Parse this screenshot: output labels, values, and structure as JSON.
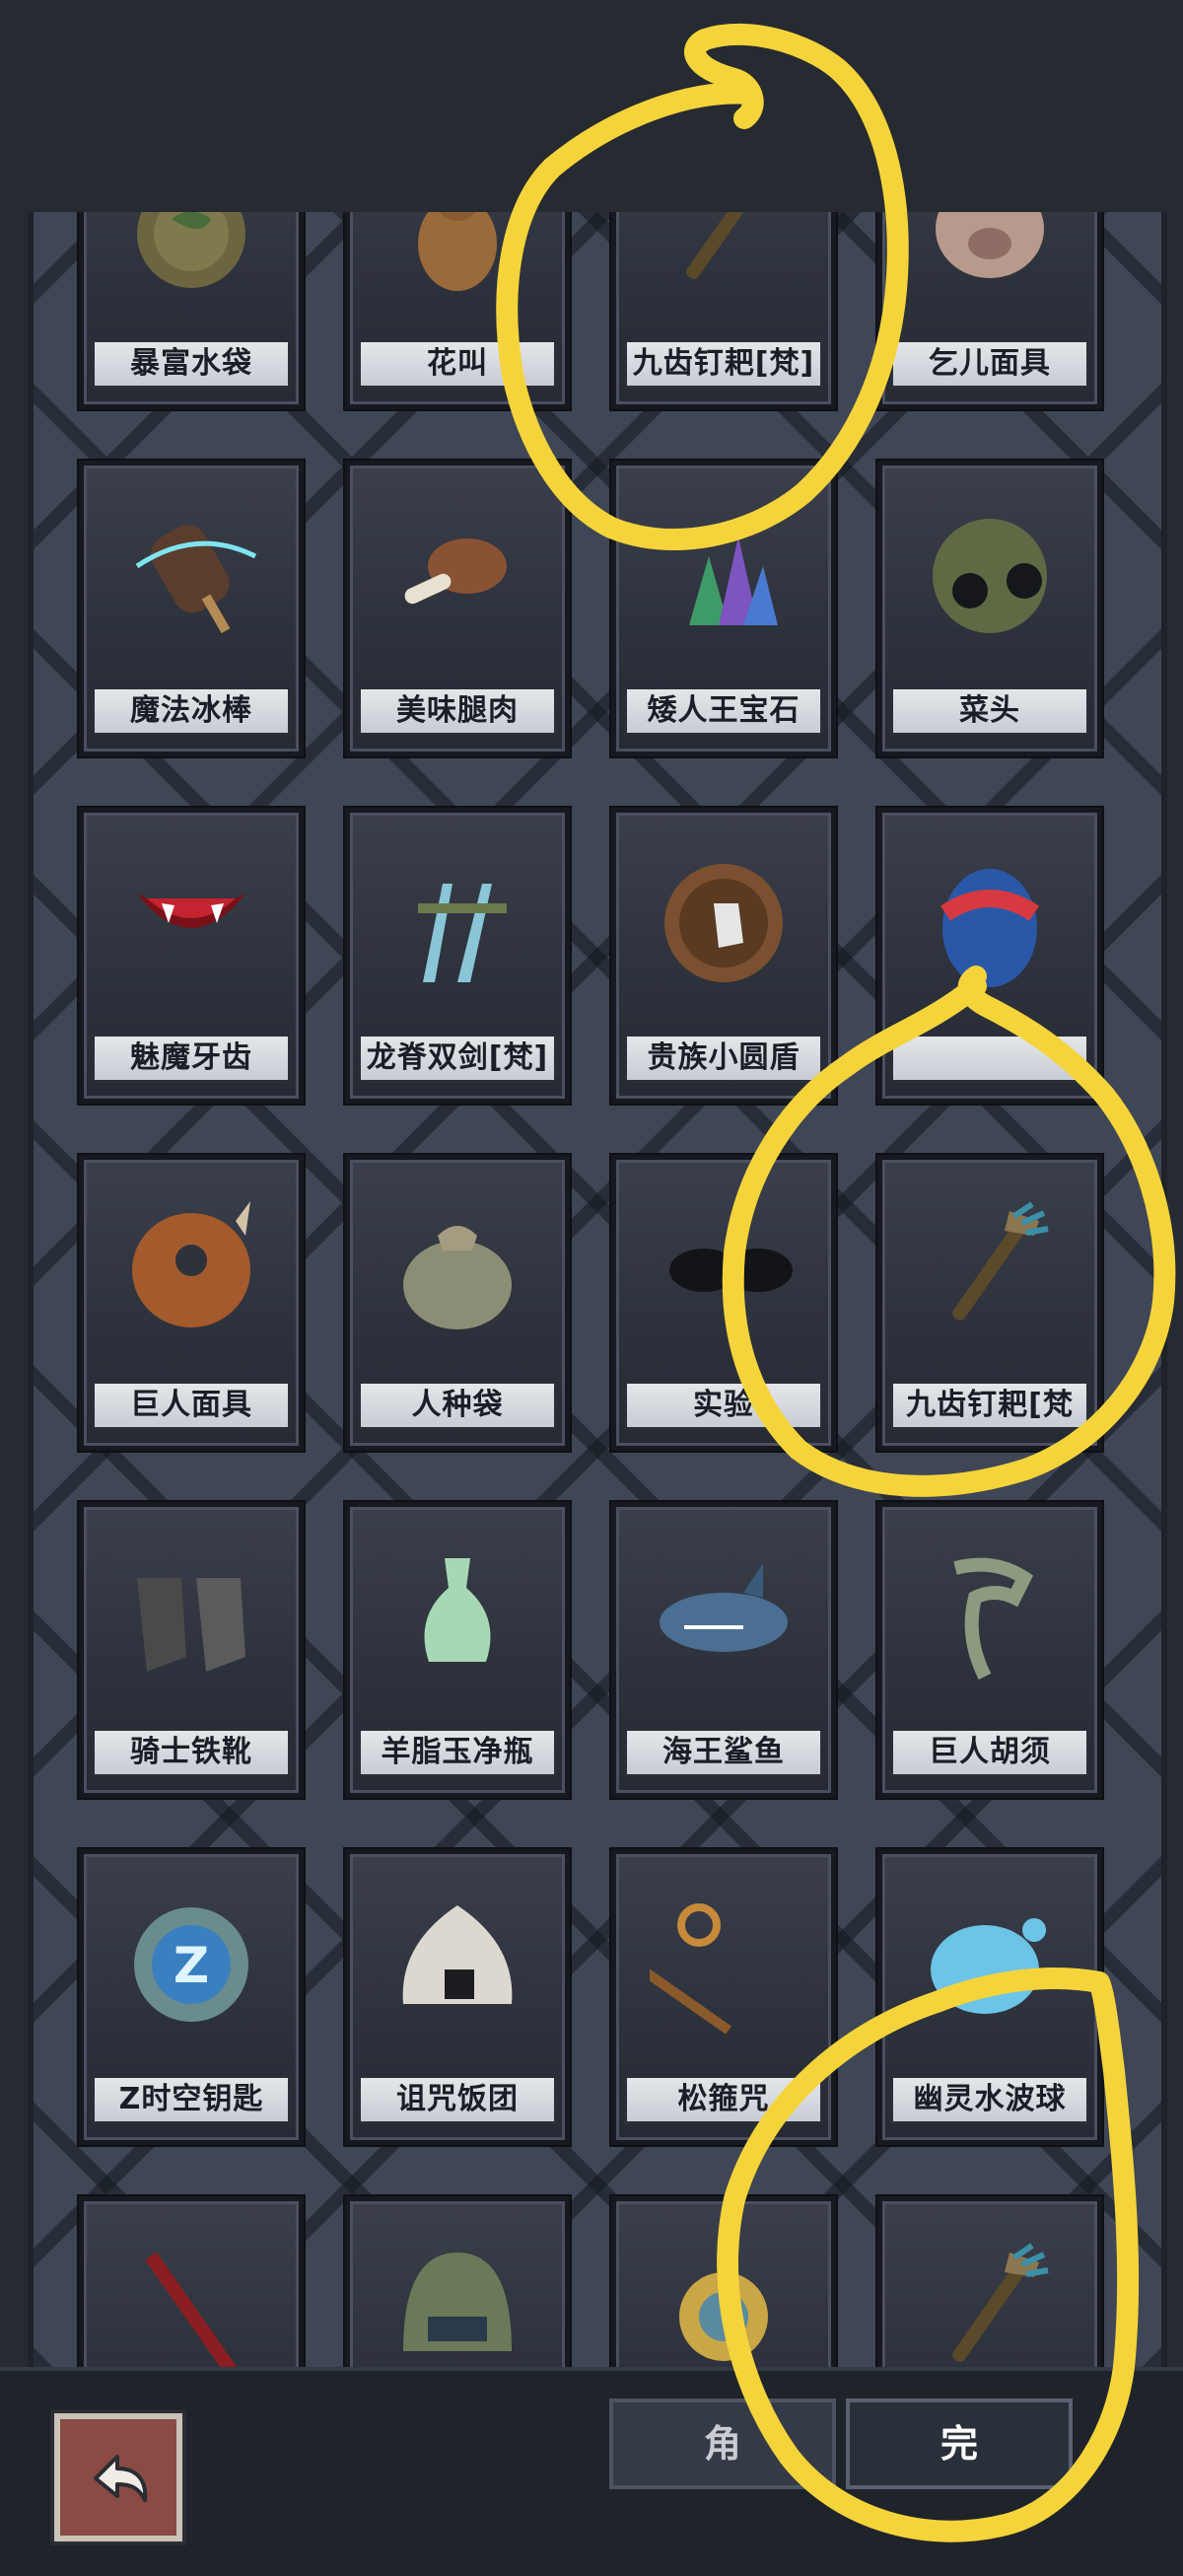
{
  "items": [
    {
      "label": "暴富水袋",
      "icon": "water-bag"
    },
    {
      "label": "花叫",
      "icon": "gourd"
    },
    {
      "label": "九齿钉耙[梵]",
      "icon": "rake"
    },
    {
      "label": "乞儿面具",
      "icon": "mask-pig"
    },
    {
      "label": "魔法冰棒",
      "icon": "ice-pop"
    },
    {
      "label": "美味腿肉",
      "icon": "meat-leg"
    },
    {
      "label": "矮人王宝石",
      "icon": "gems"
    },
    {
      "label": "菜头",
      "icon": "spiky-ball"
    },
    {
      "label": "魅魔牙齿",
      "icon": "fangs"
    },
    {
      "label": "龙脊双剑[梵]",
      "icon": "twin-swords"
    },
    {
      "label": "贵族小圆盾",
      "icon": "round-shield"
    },
    {
      "label": "",
      "icon": "egg"
    },
    {
      "label": "巨人面具",
      "icon": "giant-mask"
    },
    {
      "label": "人种袋",
      "icon": "sack"
    },
    {
      "label": "实验",
      "icon": "goggles"
    },
    {
      "label": "九齿钉耙[梵",
      "icon": "rake"
    },
    {
      "label": "骑士铁靴",
      "icon": "boots"
    },
    {
      "label": "羊脂玉净瓶",
      "icon": "vase"
    },
    {
      "label": "海王鲨鱼",
      "icon": "shark"
    },
    {
      "label": "巨人胡须",
      "icon": "beard"
    },
    {
      "label": "Z时空钥匙",
      "icon": "z-orb"
    },
    {
      "label": "诅咒饭团",
      "icon": "rice-ball"
    },
    {
      "label": "松箍咒",
      "icon": "staff-hook"
    },
    {
      "label": "幽灵水波球",
      "icon": "water-blob"
    },
    {
      "label": "",
      "icon": "red-staff"
    },
    {
      "label": "",
      "icon": "helmet"
    },
    {
      "label": "",
      "icon": "amulet"
    },
    {
      "label": "",
      "icon": "rake"
    }
  ],
  "bottom": {
    "tab_role_label": "角",
    "tab_done_label": "完"
  },
  "colors": {
    "highlight": "#f4d43a",
    "label_bg": "#d8dbe0",
    "panel": "#3f4655"
  }
}
